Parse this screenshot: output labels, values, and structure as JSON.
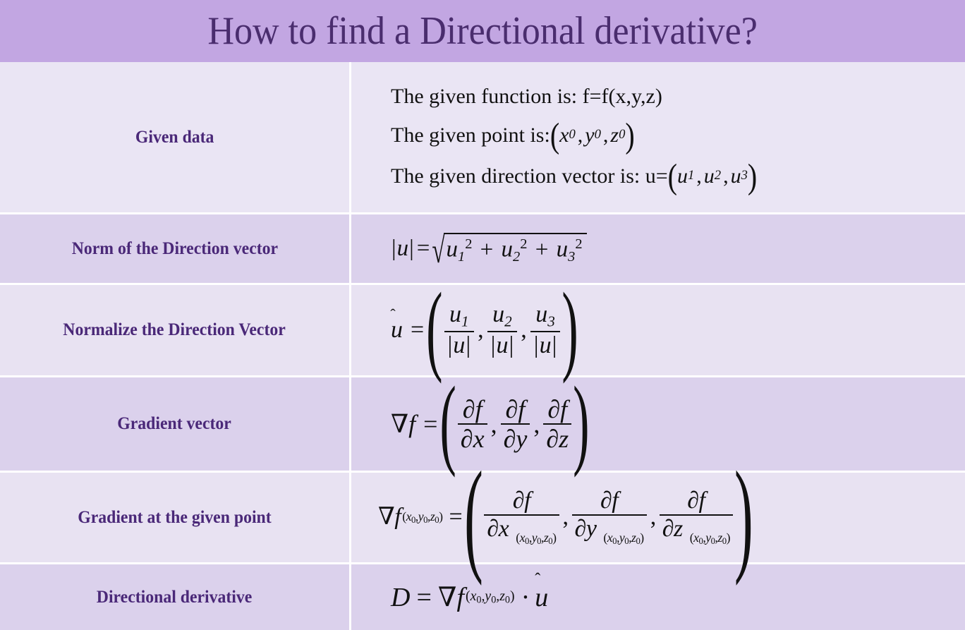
{
  "title": "How to find a Directional derivative?",
  "colors": {
    "header_bg": "#c2a6e2",
    "row_light": "#eae5f4",
    "row_dark": "#dbd1ec",
    "label_text": "#4a2878",
    "title_text": "#4a2d6e",
    "formula_text": "#111111",
    "grid_line": "#ffffff"
  },
  "rows": [
    {
      "label": "Given data",
      "formula_plain": "The given function is: f=f(x,y,z); The given point is: (x0, y0, z0); The given direction vector is: u=(u1, u2, u3)",
      "lines": [
        {
          "text": "The given function is: f=f(x,y,z)"
        },
        {
          "text_prefix": "The given point is:",
          "vector": [
            "x0",
            "y0",
            "z0"
          ]
        },
        {
          "text_prefix": "The given direction vector is: u=",
          "vector": [
            "u1",
            "u2",
            "u3"
          ]
        }
      ]
    },
    {
      "label": "Norm of the Direction vector",
      "formula_plain": "| u | = sqrt( u1^2 + u2^2 + u3^2 )"
    },
    {
      "label": "Normalize the Direction Vector",
      "formula_plain": "u-hat = ( u1/|u| , u2/|u| , u3/|u| )"
    },
    {
      "label": "Gradient vector",
      "formula_plain": "grad f = ( df/dx , df/dy , df/dz )"
    },
    {
      "label": "Gradient at the given point",
      "formula_plain": "grad f_(x0,y0,z0) = ( df/dx |(x0,y0,z0) , df/dy |(x0,y0,z0) , df/dz |(x0,y0,z0) )"
    },
    {
      "label": "Directional derivative",
      "formula_plain": "D = grad f_(x0,y0,z0) . u-hat"
    }
  ],
  "symbols": {
    "nabla": "∇",
    "partial": "∂",
    "radical": "√",
    "dot": "·",
    "equals": "=",
    "comma": ",",
    "plus": "+",
    "bar": "|",
    "lparen": "(",
    "rparen": ")",
    "u": "u",
    "f": "f",
    "D": "D",
    "x": "x",
    "y": "y",
    "z": "z",
    "one": "1",
    "two": "2",
    "three": "3",
    "zero": "0",
    "sq": "2",
    "hat": "̂"
  }
}
